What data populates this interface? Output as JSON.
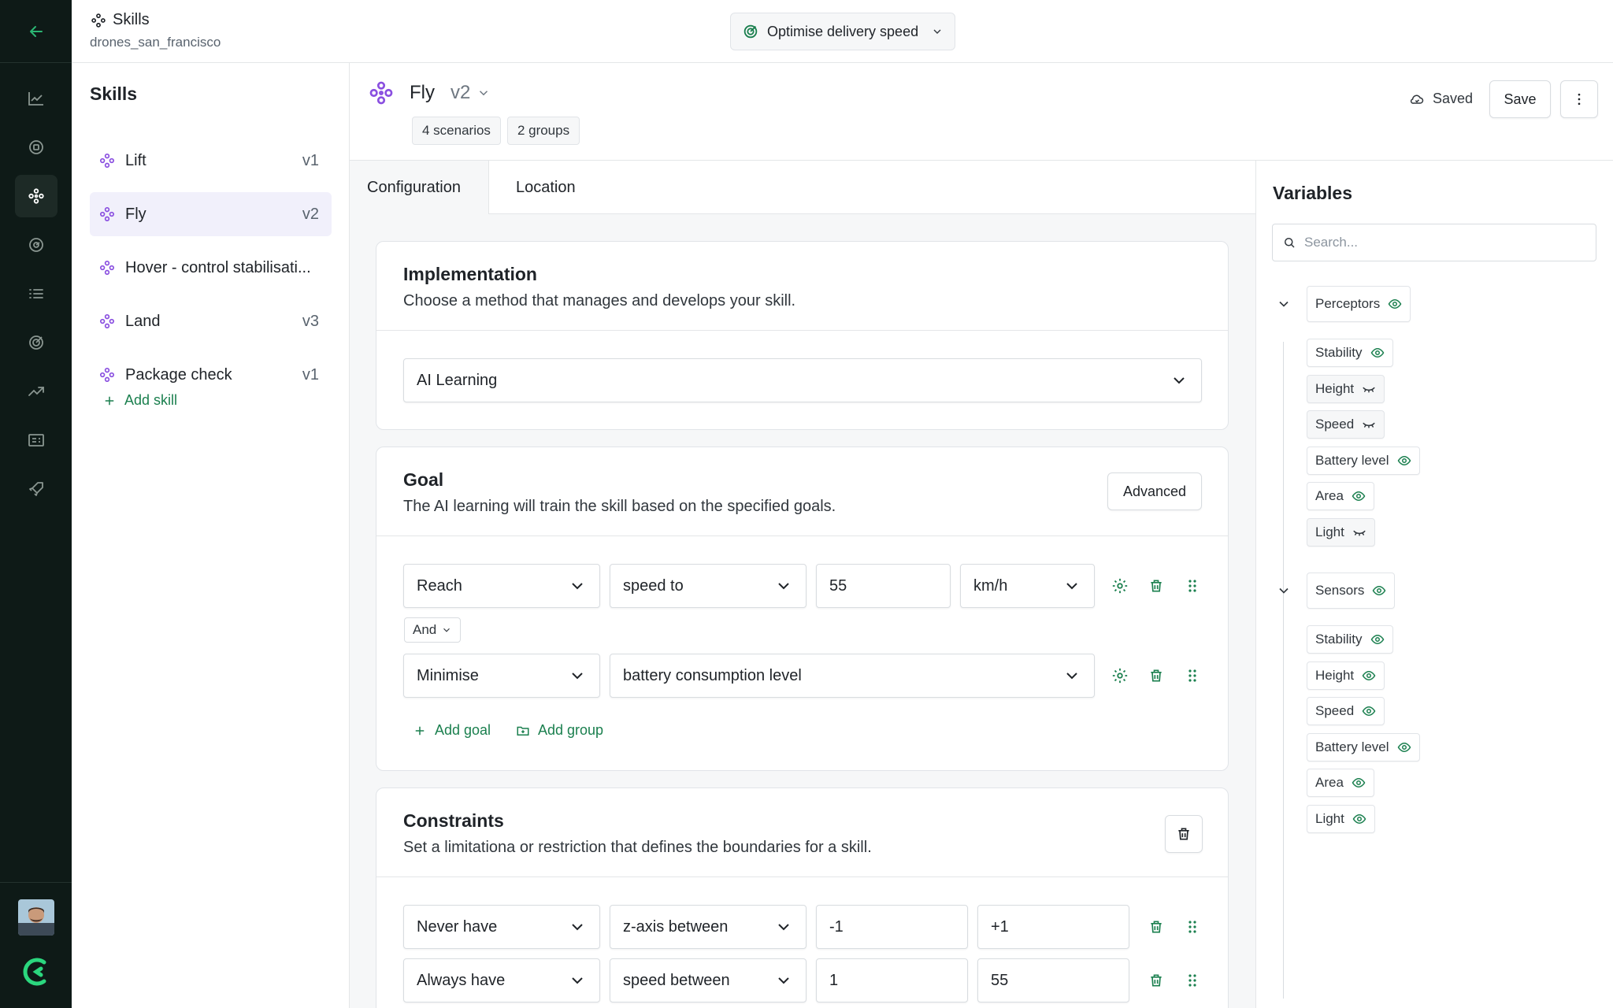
{
  "header": {
    "title": "Skills",
    "subtitle": "drones_san_francisco",
    "goal_select": "Optimise delivery speed"
  },
  "skills_panel": {
    "title": "Skills",
    "items": [
      {
        "name": "Lift",
        "version": "v1"
      },
      {
        "name": "Fly",
        "version": "v2"
      },
      {
        "name": "Hover - control stabilisati...",
        "version": ""
      },
      {
        "name": "Land",
        "version": "v3"
      },
      {
        "name": "Package check",
        "version": "v1"
      }
    ],
    "add_label": "Add skill"
  },
  "skill": {
    "name": "Fly",
    "version": "v2",
    "chips": [
      "4 scenarios",
      "2 groups"
    ],
    "saved_label": "Saved",
    "save_label": "Save"
  },
  "tabs": [
    "Configuration",
    "Location"
  ],
  "implementation": {
    "title": "Implementation",
    "description": "Choose a  method that manages and develops your skill.",
    "method": "AI Learning"
  },
  "goal": {
    "title": "Goal",
    "description": "The AI learning will train the skill based on the specified goals.",
    "advanced_label": "Advanced",
    "row1": {
      "action": "Reach",
      "metric": "speed to",
      "value": "55",
      "unit": "km/h"
    },
    "connector": "And",
    "row2": {
      "action": "Minimise",
      "metric": "battery consumption level"
    },
    "add_goal": "Add goal",
    "add_group": "Add group"
  },
  "constraints": {
    "title": "Constraints",
    "description": "Set a limitationa or restriction that defines the boundaries for a skill.",
    "row1": {
      "mode": "Never have",
      "metric": "z-axis between",
      "min": "-1",
      "max": "+1"
    },
    "row2": {
      "mode": "Always have",
      "metric": "speed between",
      "min": "1",
      "max": "55"
    }
  },
  "variables": {
    "title": "Variables",
    "search_placeholder": "Search...",
    "perceptors": {
      "label": "Perceptors",
      "items": [
        {
          "name": "Stability",
          "visible": true
        },
        {
          "name": "Height",
          "visible": false
        },
        {
          "name": "Speed",
          "visible": false
        },
        {
          "name": "Battery level",
          "visible": true
        },
        {
          "name": "Area",
          "visible": true
        },
        {
          "name": "Light",
          "visible": false
        }
      ]
    },
    "sensors": {
      "label": "Sensors",
      "items": [
        {
          "name": "Stability",
          "visible": true
        },
        {
          "name": "Height",
          "visible": true
        },
        {
          "name": "Speed",
          "visible": true
        },
        {
          "name": "Battery level",
          "visible": true
        },
        {
          "name": "Area",
          "visible": true
        },
        {
          "name": "Light",
          "visible": true
        }
      ]
    }
  },
  "colors": {
    "accent_green": "#1a7f4e",
    "skill_purple": "#8a4fe0",
    "rail_bg": "#0e1a17"
  }
}
